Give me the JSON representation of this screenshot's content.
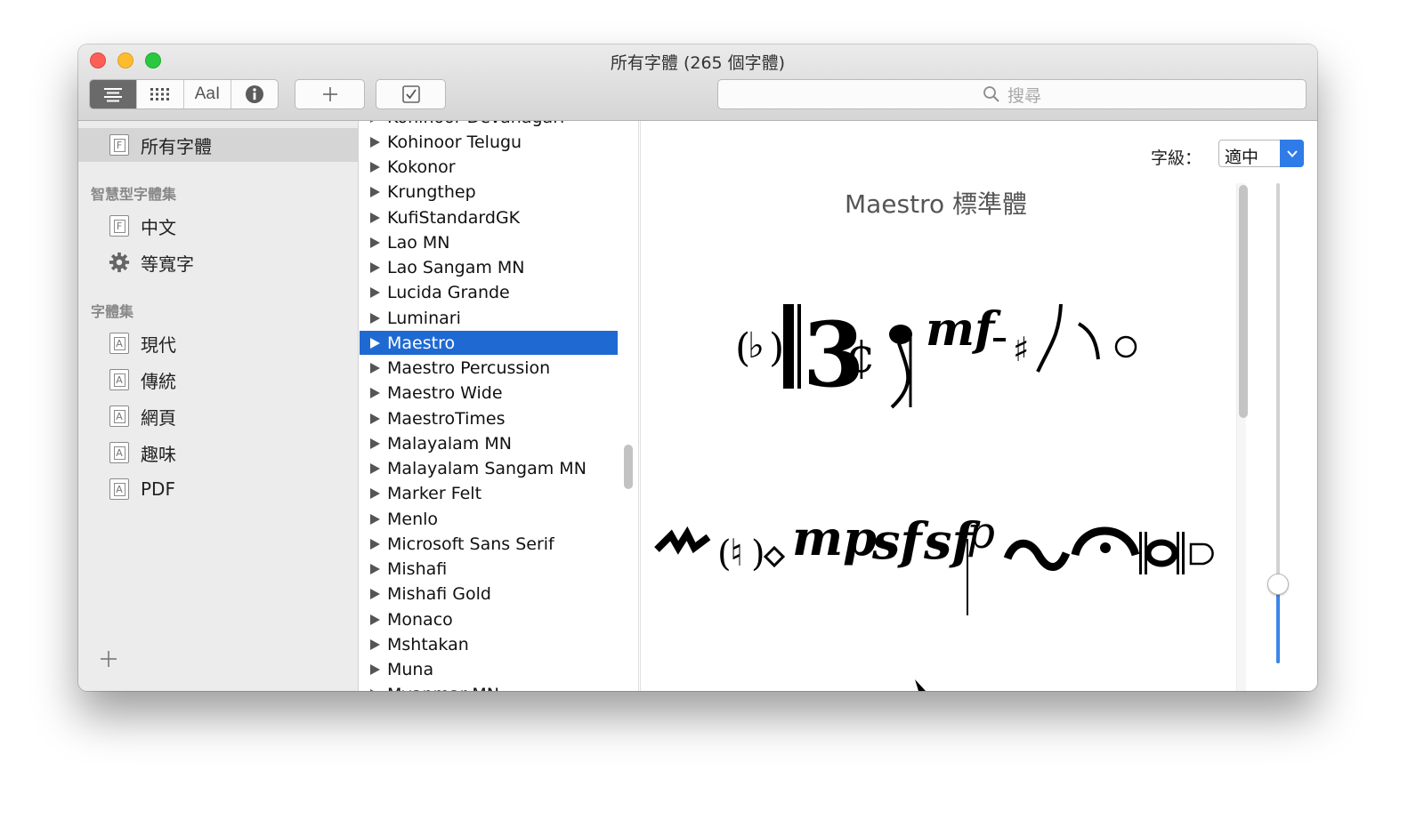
{
  "window": {
    "title": "所有字體 (265 個字體)"
  },
  "toolbar": {
    "aa_label": "AaI",
    "search_placeholder": "搜尋"
  },
  "sidebar": {
    "all_fonts": "所有字體",
    "smart_header": "智慧型字體集",
    "smart": [
      "中文",
      "等寬字"
    ],
    "collections_header": "字體集",
    "collections": [
      "現代",
      "傳統",
      "網頁",
      "趣味",
      "PDF"
    ],
    "icon_letter_f": "F",
    "icon_letter_a": "A"
  },
  "font_list": {
    "items": [
      "Kohinoor Devanagari",
      "Kohinoor Telugu",
      "Kokonor",
      "Krungthep",
      "KufiStandardGK",
      "Lao MN",
      "Lao Sangam MN",
      "Lucida Grande",
      "Luminari",
      "Maestro",
      "Maestro Percussion",
      "Maestro Wide",
      "MaestroTimes",
      "Malayalam MN",
      "Malayalam Sangam MN",
      "Marker Felt",
      "Menlo",
      "Microsoft Sans Serif",
      "Mishafi",
      "Mishafi Gold",
      "Monaco",
      "Mshtakan",
      "Muna",
      "Myanmar MN"
    ],
    "selected": "Maestro"
  },
  "preview": {
    "size_label": "字級：",
    "size_value": "適中",
    "font_title": "Maestro 標準體",
    "glyph_row_1": "(♭)𝄡𝄡𝄴♪ mf -♯♪♩○",
    "glyph_row_2": "𝆓(♮)◇ mp sf sfp ∾ 𝄐 ‖◎‖ ▢",
    "size_slider_level": 0.16
  },
  "colors": {
    "selection": "#1f69d3",
    "accent": "#2f7ce8",
    "close": "#fc5f57",
    "minimize": "#fdbc2e",
    "maximize": "#29c840"
  }
}
